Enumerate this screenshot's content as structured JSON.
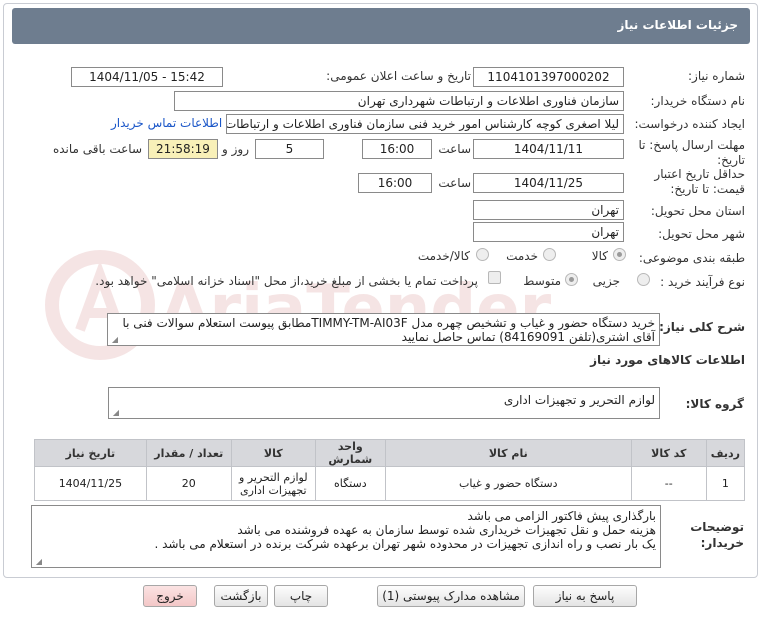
{
  "header": {
    "title": "جزئیات اطلاعات نیاز"
  },
  "fields": {
    "need_number_label": "شماره نیاز:",
    "need_number": "1104101397000202",
    "announce_label": "تاریخ و ساعت اعلان عمومی:",
    "announce_value": "1404/11/05 - 15:42",
    "buyer_org_label": "نام دستگاه خریدار:",
    "buyer_org": "سازمان فناوری اطلاعات و ارتباطات شهرداری تهران",
    "creator_label": "ایجاد کننده درخواست:",
    "creator": "لیلا اصغری کوچه کارشناس امور خرید فنی سازمان فناوری اطلاعات و ارتباطات ش",
    "contact_link": "اطلاعات تماس خریدار",
    "deadline_label_1": "مهلت ارسال پاسخ: تا",
    "deadline_label_2": "تاریخ:",
    "deadline_date": "1404/11/11",
    "time_label": "ساعت",
    "deadline_time": "16:00",
    "days_value": "5",
    "days_label": "روز و",
    "remaining_time": "21:58:19",
    "remaining_label": "ساعت باقی مانده",
    "validity_label_1": "حداقل تاریخ اعتبار",
    "validity_label_2": "قیمت: تا تاریخ:",
    "validity_date": "1404/11/25",
    "validity_time_label": "ساعت",
    "validity_time": "16:00",
    "province_label": "استان محل تحویل:",
    "province": "تهران",
    "city_label": "شهر محل تحویل:",
    "city": "تهران",
    "category_label": "طبقه بندی موضوعی:",
    "category_options": [
      "کالا",
      "خدمت",
      "کالا/خدمت"
    ],
    "purchase_type_label": "نوع فرآیند خرید :",
    "purchase_options": [
      "جزیی",
      "متوسط"
    ],
    "payment_note": "پرداخت تمام یا بخشی از مبلغ خرید،از محل \"اسناد خزانه اسلامی\" خواهد بود.",
    "description_label": "شرح کلی نیاز:",
    "description": "خرید دستگاه حضور و غیاب و تشخیص چهره مدل TIMMY-TM-AI03Fمطابق پیوست استعلام سوالات فنی با آقای اشتری(تلفن 84169091) تماس حاصل نمایید",
    "goods_info_title": "اطلاعات کالاهای مورد نیاز",
    "goods_group_label": "گروه کالا:",
    "goods_group": "لوازم التحریر و تجهیزات اداری",
    "buyer_notes_label_1": "توضیحات",
    "buyer_notes_label_2": "خریدار:",
    "buyer_notes": [
      "بارگذاری پیش فاکتور الزامی می باشد",
      "هزینه حمل و نقل تجهیزات خریداری شده توسط سازمان به عهده فروشنده می باشد",
      "یک بار نصب  و راه اندازی تجهیزات در محدوده شهر تهران برعهده شرکت برنده در استعلام می باشد ."
    ]
  },
  "table": {
    "headers": [
      "ردیف",
      "کد کالا",
      "نام کالا",
      "واحد شمارش",
      "کالا",
      "تعداد / مقدار",
      "تاریخ نیاز"
    ],
    "rows": [
      [
        "1",
        "--",
        "دستگاه حضور و غیاب",
        "دستگاه",
        "لوازم التحریر و تجهیزات اداری",
        "20",
        "1404/11/25"
      ]
    ]
  },
  "buttons": {
    "reply": "پاسخ به نیاز",
    "view_docs": "مشاهده مدارک پیوستی (1)",
    "print": "چاپ",
    "back": "بازگشت",
    "exit": "خروج"
  },
  "watermark": "AriaTender.neT"
}
